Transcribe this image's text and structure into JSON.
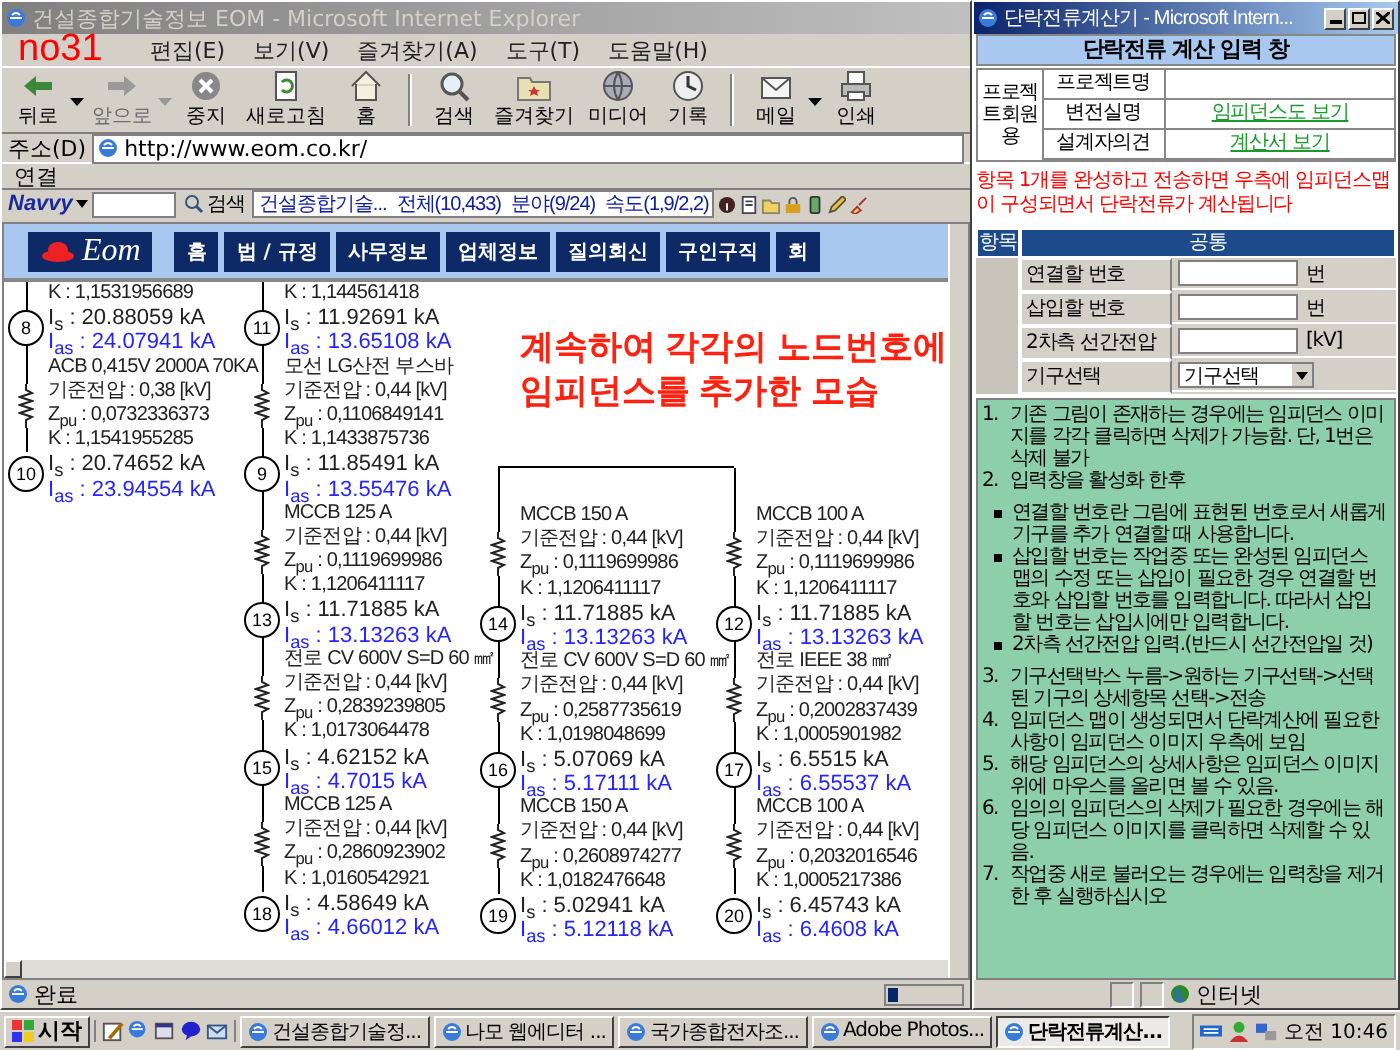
{
  "browser": {
    "title": "건설종합기술정보 EOM - Microsoft Internet Explorer",
    "active": false,
    "annotation": "no31",
    "menu": [
      "편집(E)",
      "보기(V)",
      "즐겨찾기(A)",
      "도구(T)",
      "도움말(H)"
    ],
    "toolbar": [
      {
        "kind": "button",
        "label": "뒤로",
        "dropdown": true,
        "disabled": false
      },
      {
        "kind": "button",
        "label": "앞으로",
        "dropdown": true,
        "disabled": true
      },
      {
        "kind": "button",
        "label": "중지",
        "dropdown": false,
        "disabled": false
      },
      {
        "kind": "button",
        "label": "새로고침",
        "dropdown": false,
        "disabled": false
      },
      {
        "kind": "button",
        "label": "홈",
        "dropdown": false,
        "disabled": false
      },
      {
        "kind": "separator"
      },
      {
        "kind": "button",
        "label": "검색",
        "dropdown": false,
        "disabled": false
      },
      {
        "kind": "button",
        "label": "즐겨찾기",
        "dropdown": false,
        "disabled": false
      },
      {
        "kind": "button",
        "label": "미디어",
        "dropdown": false,
        "disabled": false
      },
      {
        "kind": "button",
        "label": "기록",
        "dropdown": false,
        "disabled": false
      },
      {
        "kind": "separator"
      },
      {
        "kind": "button",
        "label": "메일",
        "dropdown": true,
        "disabled": false
      },
      {
        "kind": "button",
        "label": "인쇄",
        "dropdown": false,
        "disabled": false
      }
    ],
    "address": {
      "label": "주소(D)",
      "value": "http://www.eom.co.kr/"
    },
    "links_label": "연결",
    "navvy": {
      "brand": "Navvy",
      "search_button": "검색",
      "info": [
        "건설종합기술...",
        "전체(10,433)",
        "분야(9/24)",
        "속도(1,9/2,2)"
      ]
    },
    "site": {
      "logo": "Eom",
      "nav": [
        "홈",
        "법 / 규정",
        "사무정보",
        "업체정보",
        "질의회신",
        "구인구직",
        "회"
      ]
    },
    "annotation_lines": [
      "계속하여 각각의 노드번호에",
      "임피던스를 추가한 모습"
    ],
    "diagram": {
      "columns": [
        {
          "items": [
            {
              "kind": "text",
              "lines": [
                "K : 1,1531956689"
              ]
            },
            {
              "kind": "node",
              "number": "8",
              "is": "I$_{s}$ : 20.88059 kA",
              "ias": "I$_{as}$ : 24.07941 kA"
            },
            {
              "kind": "branch",
              "lines": [
                "ACB 0,415V 2000A 70KA",
                "기준전압 : 0,38 [kV]",
                "Z$_{pu}$ : 0,0732336373",
                "K : 1,1541955285"
              ]
            },
            {
              "kind": "node",
              "number": "10",
              "is": "I$_{s}$ : 20.74652 kA",
              "ias": "I$_{as}$ : 23.94554 kA"
            }
          ]
        },
        {
          "items": [
            {
              "kind": "text",
              "lines": [
                "K : 1,144561418"
              ]
            },
            {
              "kind": "node",
              "number": "11",
              "is": "I$_{s}$ : 11.92691 kA",
              "ias": "I$_{as}$ : 13.65108 kA"
            },
            {
              "kind": "branch",
              "lines": [
                "모선 LG산전 부스바",
                "기준전압 : 0,44 [kV]",
                "Z$_{pu}$ : 0,1106849141",
                "K : 1,1433875736"
              ]
            },
            {
              "kind": "node",
              "number": "9",
              "is": "I$_{s}$ : 11.85491 kA",
              "ias": "I$_{as}$ : 13.55476 kA"
            },
            {
              "kind": "branch",
              "lines": [
                "MCCB 125 A",
                "기준전압 : 0,44 [kV]",
                "Z$_{pu}$ : 0,1119699986",
                "K : 1,1206411117"
              ]
            },
            {
              "kind": "node",
              "number": "13",
              "is": "I$_{s}$ : 11.71885 kA",
              "ias": "I$_{as}$ : 13.13263 kA"
            },
            {
              "kind": "branch",
              "lines": [
                "전로 CV 600V S=D 60 ㎟",
                "기준전압 : 0,44 [kV]",
                "Z$_{pu}$ : 0,2839239805",
                "K : 1,0173064478"
              ]
            },
            {
              "kind": "node",
              "number": "15",
              "is": "I$_{s}$ : 4.62152 kA",
              "ias": "I$_{as}$ : 4.7015 kA"
            },
            {
              "kind": "branch",
              "lines": [
                "MCCB 125 A",
                "기준전압 : 0,44 [kV]",
                "Z$_{pu}$ : 0,2860923902",
                "K : 1,0160542921"
              ]
            },
            {
              "kind": "node",
              "number": "18",
              "is": "I$_{s}$ : 4.58649 kA",
              "ias": "I$_{as}$ : 4.66012 kA"
            }
          ]
        }
      ],
      "bus_columns": [
        {
          "items": [
            {
              "kind": "branch",
              "lines": [
                "MCCB 150 A",
                "기준전압 : 0,44 [kV]",
                "Z$_{pu}$ : 0,1119699986",
                "K : 1,1206411117"
              ]
            },
            {
              "kind": "node",
              "number": "14",
              "is": "I$_{s}$ : 11.71885 kA",
              "ias": "I$_{as}$ : 13.13263 kA"
            },
            {
              "kind": "branch",
              "lines": [
                "전로 CV 600V S=D 60 ㎟",
                "기준전압 : 0,44 [kV]",
                "Z$_{pu}$ : 0,2587735619",
                "K : 1,0198048699"
              ]
            },
            {
              "kind": "node",
              "number": "16",
              "is": "I$_{s}$ : 5.07069 kA",
              "ias": "I$_{as}$ : 5.17111 kA"
            },
            {
              "kind": "branch",
              "lines": [
                "MCCB 150 A",
                "기준전압 : 0,44 [kV]",
                "Z$_{pu}$ : 0,2608974277",
                "K : 1,0182476648"
              ]
            },
            {
              "kind": "node",
              "number": "19",
              "is": "I$_{s}$ : 5.02941 kA",
              "ias": "I$_{as}$ : 5.12118 kA"
            }
          ]
        },
        {
          "items": [
            {
              "kind": "branch",
              "lines": [
                "MCCB 100 A",
                "기준전압 : 0,44 [kV]",
                "Z$_{pu}$ : 0,1119699986",
                "K : 1,1206411117"
              ]
            },
            {
              "kind": "node",
              "number": "12",
              "is": "I$_{s}$ : 11.71885 kA",
              "ias": "I$_{as}$ : 13.13263 kA"
            },
            {
              "kind": "branch",
              "lines": [
                "전로 IEEE 38 ㎟",
                "기준전압 : 0,44 [kV]",
                "Z$_{pu}$ : 0,2002837439",
                "K : 1,0005901982"
              ]
            },
            {
              "kind": "node",
              "number": "17",
              "is": "I$_{s}$ : 6.5515 kA",
              "ias": "I$_{as}$ : 6.55537 kA"
            },
            {
              "kind": "branch",
              "lines": [
                "MCCB 100 A",
                "기준전압 : 0,44 [kV]",
                "Z$_{pu}$ : 0,2032016546",
                "K : 1,0005217386"
              ]
            },
            {
              "kind": "node",
              "number": "20",
              "is": "I$_{s}$ : 6.45743 kA",
              "ias": "I$_{as}$ : 6.4608 kA"
            }
          ]
        }
      ]
    },
    "status": {
      "text": "완료",
      "level": 0.15
    }
  },
  "calculator": {
    "title": "단락전류계산기 - Microsoft Intern...",
    "active": true,
    "heading": "단락전류 계산 입력 창",
    "member_label": "프로젝트회원용",
    "project_rows": [
      {
        "label": "프로젝트명"
      },
      {
        "label": "변전실명",
        "link": "임피던스도 보기"
      },
      {
        "label": "설계자의견",
        "link": "계산서 보기"
      }
    ],
    "notice": "항목 1개를 완성하고 전송하면 우측에 임피던스맵이 구성되면서 단락전류가 계산됩니다",
    "form_headers": [
      "항목",
      "공통"
    ],
    "form_rows": [
      {
        "kind": "input",
        "label": "연결할 번호",
        "unit": "번"
      },
      {
        "kind": "input",
        "label": "삽입할 번호",
        "unit": "번"
      },
      {
        "kind": "input",
        "label": "2차측 선간전압",
        "unit": "[kV]"
      },
      {
        "kind": "select",
        "label": "기구선택",
        "value": "기구선택"
      }
    ],
    "instructions": [
      {
        "kind": "numbered",
        "marker": "1.",
        "text": "기존 그림이 존재하는 경우에는 임피던스 이미지를 각각 클릭하면 삭제가 가능함. 단, 1번은 삭제 불가"
      },
      {
        "kind": "numbered",
        "marker": "2.",
        "text": "입력창을 활성화 한후"
      },
      {
        "kind": "bullet",
        "text": "연결할 번호란 그림에 표현된 번호로서 새롭게 기구를 추가 연결할 때 사용합니다."
      },
      {
        "kind": "bullet",
        "text": "삽입할 번호는 작업중 또는 완성된 임피던스 맵의 수정 또는 삽입이 필요한 경우 연결할 번호와 삽입할 번호를 입력합니다. 따라서 삽입할 번호는 삽입시에만 입력합니다."
      },
      {
        "kind": "bullet",
        "text": "2차측 선간전압 입력.(반드시 선간전압일 것)"
      },
      {
        "kind": "numbered",
        "marker": "3.",
        "text": "기구선택박스 누름->원하는 기구선택->선택된 기구의 상세항목 선택->전송"
      },
      {
        "kind": "numbered",
        "marker": "4.",
        "text": "임피던스 맵이 생성되면서 단락계산에 필요한 사항이 임피던스 이미지 우측에 보임"
      },
      {
        "kind": "numbered",
        "marker": "5.",
        "text": "해당 임피던스의 상세사항은 임피던스 이미지 위에 마우스를 올리면 볼 수 있음."
      },
      {
        "kind": "numbered",
        "marker": "6.",
        "text": "임의의 임피던스의 삭제가 필요한 경우에는 해당 임피던스 이미지를 클릭하면 삭제할 수 있음."
      },
      {
        "kind": "numbered",
        "marker": "7.",
        "text": "작업중 새로 불러오는 경우에는 입력창을 제거한 후 실행하십시오"
      }
    ],
    "status": "인터넷"
  },
  "taskbar": {
    "start": "시작",
    "tasks": [
      {
        "label": "건설종합기술정...",
        "selected": false
      },
      {
        "label": "나모 웹에디터 ...",
        "selected": false
      },
      {
        "label": "국가종합전자조...",
        "selected": false
      },
      {
        "label": "Adobe Photos...",
        "selected": false
      },
      {
        "label": "단락전류계산...",
        "selected": true
      }
    ],
    "clock": "오전 10:46"
  }
}
